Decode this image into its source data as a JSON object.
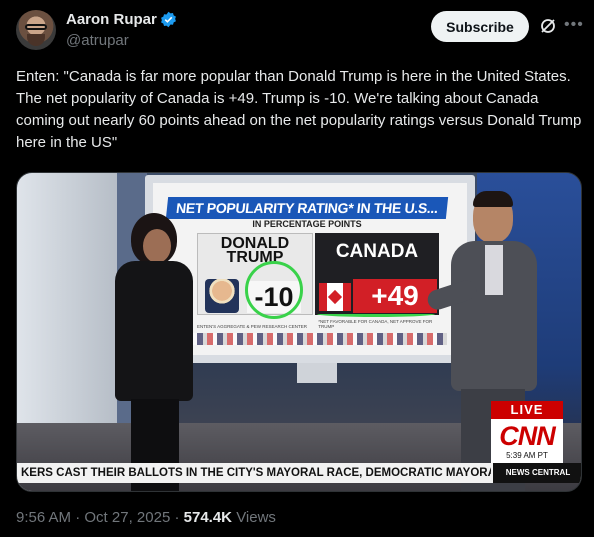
{
  "author": {
    "name": "Aaron Rupar",
    "handle": "@atrupar",
    "verified_color": "#1d9bf0"
  },
  "actions": {
    "subscribe_label": "Subscribe",
    "grok_icon": "grok-icon",
    "more_icon": "more-icon"
  },
  "post": {
    "text": "Enten: \"Canada is far more popular than Donald Trump is here in the United States. The net popularity of Canada is +49. Trump is -10. We're talking about Canada coming out nearly 60 points ahead on the net popularity ratings versus Donald Trump here in the US\""
  },
  "media": {
    "graphic": {
      "title": "NET POPULARITY RATING* IN THE U.S...",
      "subtitle": "IN PERCENTAGE POINTS",
      "left_label": "DONALD TRUMP",
      "left_value": "-10",
      "right_label": "CANADA",
      "right_value": "+49",
      "fine_left": "ENTEN'S AGGREGATE & PEW RESEARCH CENTER",
      "fine_right": "*NET FAVORABLE FOR CANADA, NET APPROVE FOR TRUMP"
    },
    "broadcast": {
      "live_label": "LIVE",
      "network": "CNN",
      "time": "5:39 AM PT",
      "ticker": "KERS CAST THEIR BALLOTS IN THE CITY'S MAYORAL RACE, DEMOCRATIC MAYORAL NC",
      "ticker_tag": "NEWS CENTRAL"
    },
    "annotation_color": "#39d24a"
  },
  "footer": {
    "time": "9:56 AM",
    "separator": "·",
    "date": "Oct 27, 2025",
    "views_count": "574.4K",
    "views_label": "Views"
  }
}
